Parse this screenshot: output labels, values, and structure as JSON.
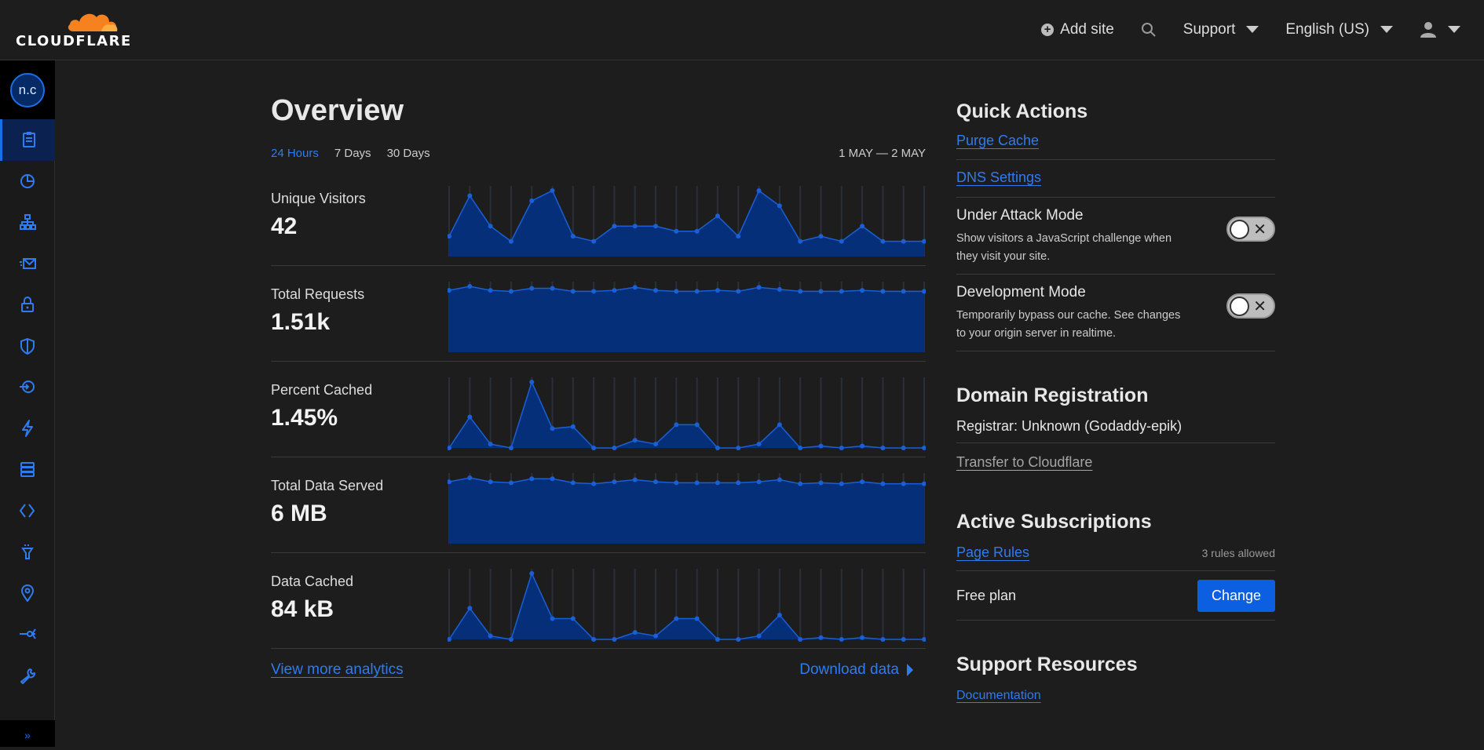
{
  "brand": {
    "logo_text": "CLOUDFLARE",
    "logo_color": "#f6821f"
  },
  "topbar": {
    "add_site": "Add site",
    "support": "Support",
    "language": "English (US)"
  },
  "sidebar": {
    "avatar": "n.c",
    "icons": [
      "overview-icon",
      "analytics-icon",
      "dns-icon",
      "email-icon",
      "ssl-lock-icon",
      "firewall-shield-icon",
      "access-icon",
      "speed-bolt-icon",
      "caching-icon",
      "workers-icon",
      "page-rules-icon",
      "network-pin-icon",
      "traffic-icon",
      "custom-pages-wrench-icon"
    ],
    "collapse": "»"
  },
  "overview": {
    "title": "Overview",
    "ranges": [
      "24 Hours",
      "7 Days",
      "30 Days"
    ],
    "active_range": "24 Hours",
    "date_range": "1 MAY — 2 MAY",
    "stats": [
      {
        "label": "Unique Visitors",
        "value": "42"
      },
      {
        "label": "Total Requests",
        "value": "1.51k"
      },
      {
        "label": "Percent Cached",
        "value": "1.45%"
      },
      {
        "label": "Total Data Served",
        "value": "6 MB"
      },
      {
        "label": "Data Cached",
        "value": "84 kB"
      }
    ],
    "view_more": "View more analytics",
    "download": "Download data"
  },
  "chart_data": [
    {
      "type": "area",
      "title": "Unique Visitors",
      "values": [
        2,
        6,
        3,
        1.5,
        5.5,
        6.5,
        2,
        1.5,
        3,
        3,
        3,
        2.5,
        2.5,
        4,
        2,
        6.5,
        5,
        1.5,
        2,
        1.5,
        3,
        1.5,
        1.5,
        1.5
      ]
    },
    {
      "type": "area",
      "title": "Total Requests",
      "values": [
        62,
        66,
        62,
        61,
        64,
        64,
        61,
        61,
        62,
        65,
        62,
        61,
        61,
        62,
        61,
        65,
        63,
        61,
        61,
        61,
        62,
        61,
        61,
        61
      ]
    },
    {
      "type": "area",
      "title": "Percent Cached",
      "values": [
        0,
        8,
        1,
        0,
        17,
        5,
        5.5,
        0,
        0,
        2,
        1,
        6,
        6,
        0,
        0,
        1,
        6,
        0,
        0.5,
        0,
        0.5,
        0,
        0,
        0
      ]
    },
    {
      "type": "area",
      "title": "Total Data Served",
      "values": [
        62,
        66,
        62,
        61,
        65,
        65,
        61,
        60,
        62,
        64,
        62,
        61,
        61,
        61,
        61,
        62,
        64,
        60,
        61,
        60,
        62,
        60,
        60,
        60
      ]
    },
    {
      "type": "area",
      "title": "Data Cached",
      "values": [
        0,
        9,
        1,
        0,
        19,
        6,
        6,
        0,
        0,
        2,
        1,
        6,
        6,
        0,
        0,
        1,
        7,
        0,
        0.5,
        0,
        0.5,
        0,
        0,
        0
      ]
    }
  ],
  "quick_actions": {
    "title": "Quick Actions",
    "purge_cache": "Purge Cache",
    "dns_settings": "DNS Settings",
    "under_attack_title": "Under Attack Mode",
    "under_attack_desc": "Show visitors a JavaScript challenge when they visit your site.",
    "dev_mode_title": "Development Mode",
    "dev_mode_desc": "Temporarily bypass our cache. See changes to your origin server in realtime."
  },
  "domain": {
    "title": "Domain Registration",
    "registrar": "Registrar: Unknown (Godaddy-epik)",
    "transfer": "Transfer to Cloudflare"
  },
  "subscriptions": {
    "title": "Active Subscriptions",
    "page_rules": "Page Rules",
    "rules_allowed": "3 rules allowed",
    "plan": "Free plan",
    "change": "Change"
  },
  "support": {
    "title": "Support Resources",
    "documentation": "Documentation"
  }
}
